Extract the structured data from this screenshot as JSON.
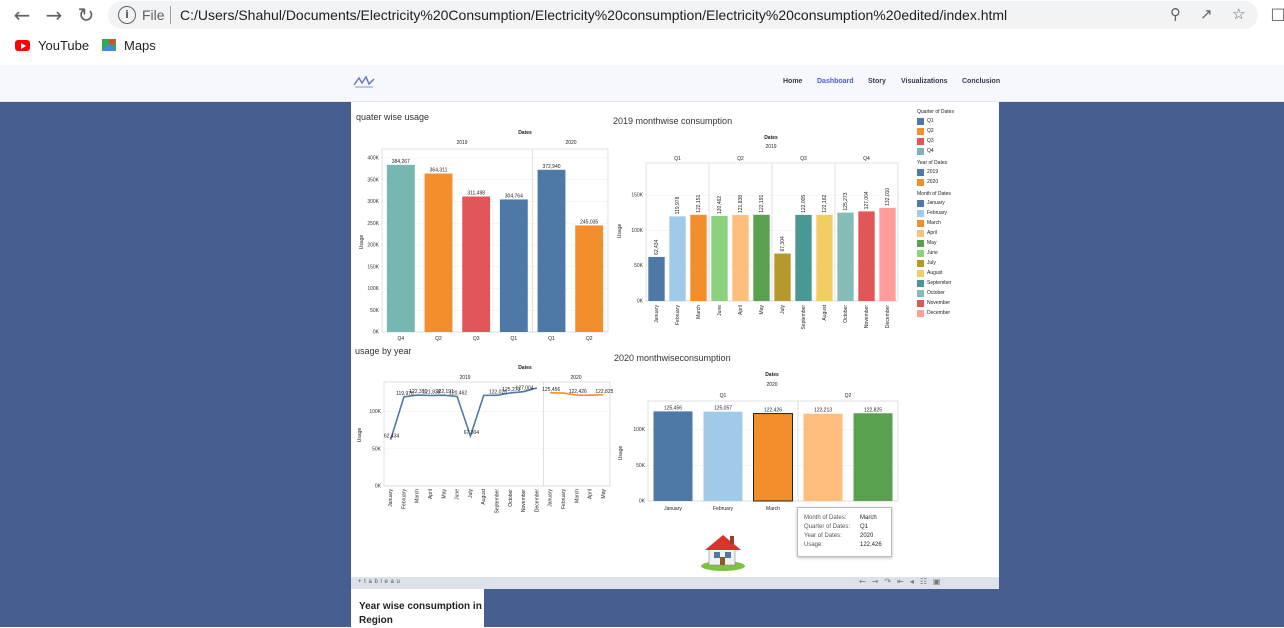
{
  "browser": {
    "url": "C:/Users/Shahul/Documents/Electricity%20Consumption/Electricity%20consumption/Electricity%20consumption%20edited/index.html",
    "scheme_label": "File",
    "bookmarks": [
      {
        "label": "YouTube"
      },
      {
        "label": "Maps"
      }
    ]
  },
  "site": {
    "nav": [
      "Home",
      "Dashboard",
      "Story",
      "Visualizations",
      "Conclusion"
    ],
    "active_nav": "Dashboard"
  },
  "colors": {
    "page_bg": "#475f90",
    "q1": "#4e79a7",
    "q2": "#f28e2b",
    "q3": "#e15759",
    "q4": "#76b7b2",
    "y2019": "#4e79a7",
    "y2020": "#f28e2b"
  },
  "quarter_chart": {
    "title": "quater wise usage",
    "header": "Dates",
    "years": [
      "2019",
      "2020"
    ],
    "ylabel": "Usage",
    "yticks": [
      "400K",
      "350K",
      "300K",
      "250K",
      "200K",
      "150K",
      "100K",
      "50K",
      "0K"
    ]
  },
  "month2019_chart": {
    "title": "2019 monthwise consumption",
    "header": "Dates",
    "year": "2019",
    "quarters": [
      "Q1",
      "Q2",
      "Q3",
      "Q4"
    ],
    "ylabel": "Usage",
    "yticks": [
      "150K",
      "100K",
      "50K",
      "0K"
    ]
  },
  "usage_year_chart": {
    "title": "usage by year",
    "header": "Dates",
    "years": [
      "2019",
      "2020"
    ],
    "ylabel": "Usage",
    "yticks": [
      "100K",
      "50K",
      "0K"
    ]
  },
  "month2020_chart": {
    "title": "2020 monthwiseconsumption",
    "header": "Dates",
    "year": "2020",
    "quarters": [
      "Q1",
      "Q2"
    ],
    "ylabel": "Usage",
    "yticks": [
      "100K",
      "50K",
      "0K"
    ]
  },
  "legend": {
    "quarter_title": "Quarter of Dates",
    "quarters": [
      {
        "label": "Q1",
        "color": "#4e79a7"
      },
      {
        "label": "Q2",
        "color": "#f28e2b"
      },
      {
        "label": "Q3",
        "color": "#e15759"
      },
      {
        "label": "Q4",
        "color": "#76b7b2"
      }
    ],
    "year_title": "Year of Dates",
    "years": [
      {
        "label": "2019",
        "color": "#4e79a7"
      },
      {
        "label": "2020",
        "color": "#f28e2b"
      }
    ],
    "month_title": "Month of Dates",
    "months": [
      {
        "label": "January",
        "color": "#4e79a7"
      },
      {
        "label": "February",
        "color": "#a0cbe8"
      },
      {
        "label": "March",
        "color": "#f28e2b"
      },
      {
        "label": "April",
        "color": "#ffbe7d"
      },
      {
        "label": "May",
        "color": "#59a14f"
      },
      {
        "label": "June",
        "color": "#8cd17d"
      },
      {
        "label": "July",
        "color": "#b6992d"
      },
      {
        "label": "August",
        "color": "#f1ce63"
      },
      {
        "label": "September",
        "color": "#499894"
      },
      {
        "label": "October",
        "color": "#86bcb6"
      },
      {
        "label": "November",
        "color": "#e15759"
      },
      {
        "label": "December",
        "color": "#ff9d9a"
      }
    ]
  },
  "tooltip": {
    "rows": [
      {
        "k": "Month of Dates:",
        "v": "March"
      },
      {
        "k": "Quarter of Dates:",
        "v": "Q1"
      },
      {
        "k": "Year of Dates:",
        "v": "2020"
      },
      {
        "k": "Usage:",
        "v": "122,426"
      }
    ]
  },
  "tableau_label": "+ t a b l e a u",
  "card": {
    "title": "Year wise consumption in Region"
  },
  "chart_data": [
    {
      "type": "bar",
      "title": "quater wise usage",
      "ylabel": "Usage",
      "ylim": [
        0,
        400000
      ],
      "groups": [
        {
          "year": "2019",
          "categories": [
            "Q4",
            "Q2",
            "Q3",
            "Q1"
          ],
          "values": [
            384267,
            364311,
            311498,
            304764
          ],
          "labels": [
            "384,267",
            "364,311",
            "311,498",
            "304,764"
          ],
          "colors": [
            "#76b7b2",
            "#f28e2b",
            "#e15759",
            "#4e79a7"
          ]
        },
        {
          "year": "2020",
          "categories": [
            "Q1",
            "Q2"
          ],
          "values": [
            372940,
            245035
          ],
          "labels": [
            "372,940",
            "245,035"
          ],
          "colors": [
            "#4e79a7",
            "#f28e2b"
          ]
        }
      ]
    },
    {
      "type": "bar",
      "title": "2019 monthwise consumption",
      "ylabel": "Usage",
      "ylim": [
        0,
        180000
      ],
      "categories": [
        "January",
        "February",
        "March",
        "June",
        "April",
        "May",
        "July",
        "September",
        "August",
        "October",
        "November",
        "December"
      ],
      "values": [
        62434,
        119978,
        122,
        120462,
        121838,
        122191,
        67304,
        122005,
        122162,
        125273,
        127004,
        132010
      ],
      "labels": [
        "62,434",
        "119,978",
        "122,151",
        "120,462",
        "121,838",
        "122,191",
        "67,304",
        "122,005",
        "122,162",
        "125,273",
        "127,004",
        "132,010"
      ],
      "quarter_of": [
        "Q1",
        "Q1",
        "Q1",
        "Q2",
        "Q2",
        "Q2",
        "Q3",
        "Q3",
        "Q3",
        "Q4",
        "Q4",
        "Q4"
      ],
      "colors": [
        "#4e79a7",
        "#a0cbe8",
        "#f28e2b",
        "#8cd17d",
        "#ffbe7d",
        "#59a14f",
        "#b6992d",
        "#499894",
        "#f1ce63",
        "#86bcb6",
        "#e15759",
        "#ff9d9a"
      ]
    },
    {
      "type": "line",
      "title": "usage by year",
      "ylabel": "Usage",
      "ylim": [
        0,
        140000
      ],
      "series": [
        {
          "name": "2019",
          "x": [
            "January",
            "February",
            "March",
            "April",
            "May",
            "June",
            "July",
            "August",
            "September",
            "October",
            "November",
            "December"
          ],
          "values": [
            62434,
            119978,
            122391,
            121838,
            122191,
            120462,
            67304,
            122005,
            122026,
            125273,
            127004,
            132010
          ],
          "labels": [
            "62,434",
            "119,978",
            "122,391",
            "121,838",
            "122,191",
            "120,462",
            "67,304",
            "",
            "122,026",
            "125,273",
            "127,004",
            ""
          ],
          "color": "#4e79a7"
        },
        {
          "name": "2020",
          "x": [
            "January",
            "February",
            "March",
            "April",
            "May"
          ],
          "values": [
            125456,
            125057,
            122426,
            122213,
            122825
          ],
          "labels": [
            "125,456",
            "",
            "122,426",
            "",
            "122,825"
          ],
          "color": "#f28e2b"
        }
      ]
    },
    {
      "type": "bar",
      "title": "2020 monthwiseconsumption",
      "ylabel": "Usage",
      "ylim": [
        0,
        140000
      ],
      "categories": [
        "January",
        "February",
        "March",
        "April",
        "May"
      ],
      "values": [
        125456,
        125057,
        122426,
        122213,
        122825
      ],
      "labels": [
        "125,456",
        "125,057",
        "122,426",
        "122,213",
        "122,825"
      ],
      "quarter_of": [
        "Q1",
        "Q1",
        "Q1",
        "Q2",
        "Q2"
      ],
      "colors": [
        "#4e79a7",
        "#a0cbe8",
        "#f28e2b",
        "#ffbe7d",
        "#59a14f"
      ]
    }
  ]
}
